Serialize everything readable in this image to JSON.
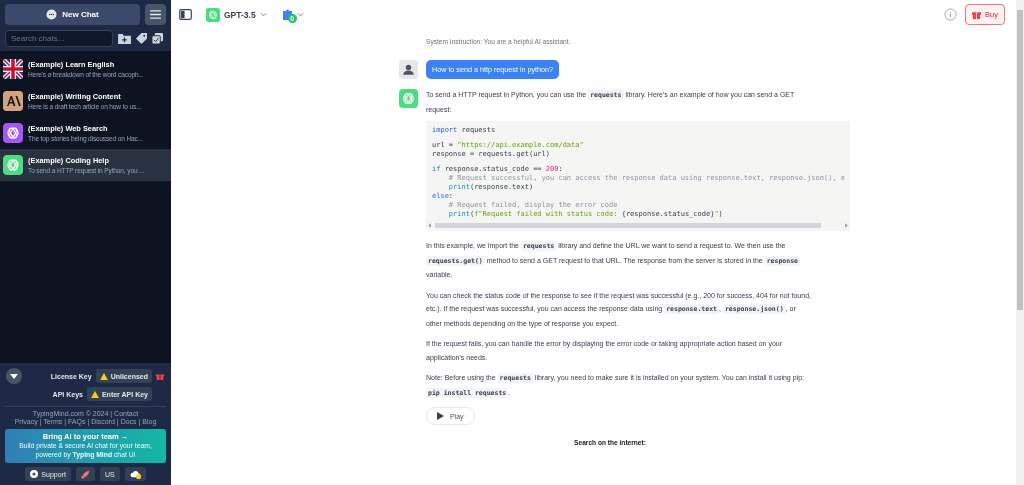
{
  "sidebar": {
    "new_chat": "New Chat",
    "search": {
      "placeholder": "Search chats..."
    },
    "chats": [
      {
        "title": "(Example) Learn English",
        "preview": "Here's a breakdown of the word cacoph...",
        "kind": "flag",
        "selected": false
      },
      {
        "title": "(Example) Writing Content",
        "preview": "Here is a draft tech article on how to us...",
        "kind": "anthropic",
        "selected": false
      },
      {
        "title": "(Example) Web Search",
        "preview": "The top stories being discussed on Hac...",
        "kind": "purple",
        "selected": false
      },
      {
        "title": "(Example) Coding Help",
        "preview": "To send a HTTP request in Python, you ...",
        "kind": "green",
        "selected": true
      }
    ],
    "license": {
      "label": "License Key",
      "value": "Unlicensed"
    },
    "api_keys": {
      "label": "API Keys",
      "value": "Enter API Key"
    },
    "footer": [
      "TypingMind.com © 2024 | Contact",
      "Privacy | Terms | FAQs | Discord | Docs | Blog"
    ],
    "promo": {
      "title": "Bring AI to your team →",
      "text": "Build private & secure AI chat for your team, powered by **Typing Mind** chat UI"
    },
    "bottom_buttons": [
      {
        "kind": "support",
        "label": "Support"
      },
      {
        "kind": "rocket"
      },
      {
        "kind": "lang",
        "label": "US"
      },
      {
        "kind": "cloud"
      }
    ]
  },
  "topbar": {
    "model": "GPT-3.5",
    "plugin_badge": "0",
    "buy": "Buy"
  },
  "chat": {
    "system": "System Instruction: You are a helpful AI assistant.",
    "user_message": "How to send a http request in python?",
    "intro": [
      {
        "kind": "text",
        "s": "To send a HTTP request in Python, you can use the "
      },
      {
        "kind": "code",
        "s": "requests"
      },
      {
        "kind": "text",
        "s": " library. Here's an example of how you can send a GET request:"
      }
    ],
    "code": [
      [
        [
          {
            "kind": "kw",
            "s": "import"
          },
          {
            "kind": "plain",
            "s": " requests"
          }
        ]
      ],
      [
        [
          {
            "kind": "plain",
            "s": "url = "
          },
          {
            "kind": "str",
            "s": "\"https://api.example.com/data\""
          }
        ],
        [
          {
            "kind": "plain",
            "s": "response = requests.get(url)"
          }
        ]
      ],
      [
        [
          {
            "kind": "kw",
            "s": "if"
          },
          {
            "kind": "plain",
            "s": " response.status_code == "
          },
          {
            "kind": "num",
            "s": "200"
          },
          {
            "kind": "plain",
            "s": ":"
          }
        ],
        [
          {
            "kind": "comment",
            "s": "    # Request successful, you can access the response data using response.text, response.json(), e"
          }
        ],
        [
          {
            "kind": "fn",
            "s": "    print"
          },
          {
            "kind": "plain",
            "s": "(response.text)"
          }
        ],
        [
          {
            "kind": "kw",
            "s": "else"
          },
          {
            "kind": "plain",
            "s": ":"
          }
        ],
        [
          {
            "kind": "comment",
            "s": "    # Request failed, display the error code"
          }
        ],
        [
          {
            "kind": "fn",
            "s": "    print"
          },
          {
            "kind": "plain",
            "s": "("
          },
          {
            "kind": "str",
            "s": "f\"Request failed with status code: "
          },
          {
            "kind": "plain",
            "s": "{response.status_code}"
          },
          {
            "kind": "str",
            "s": "\""
          },
          {
            "kind": "plain",
            "s": ")"
          }
        ]
      ]
    ],
    "paragraphs": [
      [
        {
          "kind": "text",
          "s": "In this example, we import the "
        },
        {
          "kind": "code",
          "s": "requests"
        },
        {
          "kind": "text",
          "s": " library and define the URL we want to send a request to. We then use the "
        },
        {
          "kind": "code",
          "s": "requests.get()"
        },
        {
          "kind": "text",
          "s": " method to send a GET request to that URL. The response from the server is stored in the "
        },
        {
          "kind": "code",
          "s": "response"
        },
        {
          "kind": "text",
          "s": " variable."
        }
      ],
      [
        {
          "kind": "text",
          "s": "You can check the status code of the response to see if the request was successful (e.g., 200 for success, 404 for not found, etc.). If the request was successful, you can access the response data using "
        },
        {
          "kind": "code",
          "s": "response.text"
        },
        {
          "kind": "text",
          "s": ", "
        },
        {
          "kind": "code",
          "s": "response.json()"
        },
        {
          "kind": "text",
          "s": ", or other methods depending on the type of response you expect."
        }
      ],
      [
        {
          "kind": "text",
          "s": "If the request fails, you can handle the error by displaying the error code or taking appropriate action based on your application's needs."
        }
      ],
      [
        {
          "kind": "text",
          "s": "Note: Before using the "
        },
        {
          "kind": "code",
          "s": "requests"
        },
        {
          "kind": "text",
          "s": " library, you need to make sure it is installed on your system. You can install it using pip: "
        },
        {
          "kind": "code",
          "s": "pip install requests"
        },
        {
          "kind": "text",
          "s": "."
        }
      ]
    ],
    "play": "Play",
    "search_label": "Search on the internet:"
  }
}
